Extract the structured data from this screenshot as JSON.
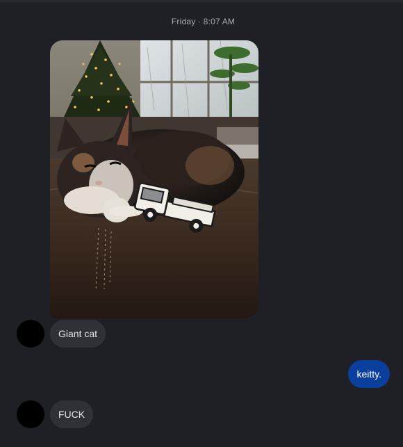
{
  "conversation": {
    "timestamp": "Friday · 8:07 AM",
    "messages": [
      {
        "sender": "other",
        "text": "Giant cat"
      },
      {
        "sender": "me",
        "text": "keitty."
      },
      {
        "sender": "other",
        "text": "FUCK"
      }
    ]
  },
  "colors": {
    "background": "#1f2025",
    "incoming_bubble": "#303136",
    "outgoing_bubble": "#0b3f9e",
    "timestamp_text": "#a9abb2"
  }
}
